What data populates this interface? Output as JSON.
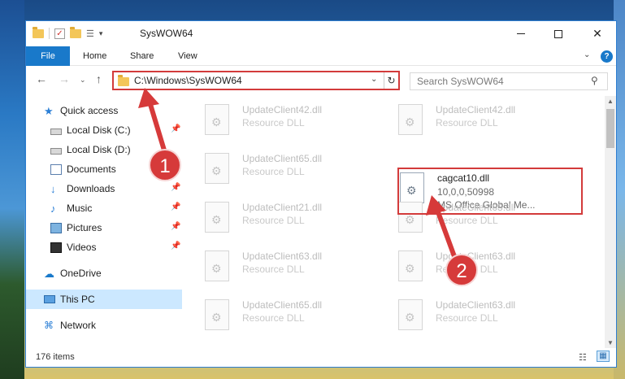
{
  "window": {
    "title": "SysWOW64",
    "controls": {
      "minimize": "—",
      "maximize": "☐",
      "close": "✕"
    }
  },
  "quick_access_toolbar": {
    "dropdown": "▾"
  },
  "ribbon": {
    "tabs": [
      "File",
      "Home",
      "Share",
      "View"
    ],
    "help": "?",
    "expand": "⌄"
  },
  "navigation": {
    "back": "←",
    "forward": "→",
    "recent": "⌄",
    "up": "↑",
    "address": "C:\\Windows\\SysWOW64",
    "address_dropdown": "⌄",
    "refresh": "↻",
    "search_placeholder": "Search SysWOW64",
    "search_icon": "⚲"
  },
  "sidebar": {
    "items": [
      {
        "label": "Quick access",
        "icon": "star-icon",
        "pinned": false
      },
      {
        "label": "Local Disk (C:)",
        "icon": "disk-icon",
        "pinned": true
      },
      {
        "label": "Local Disk (D:)",
        "icon": "disk-icon",
        "pinned": true
      },
      {
        "label": "Documents",
        "icon": "documents-icon",
        "pinned": true
      },
      {
        "label": "Downloads",
        "icon": "downloads-icon",
        "pinned": true
      },
      {
        "label": "Music",
        "icon": "music-icon",
        "pinned": true
      },
      {
        "label": "Pictures",
        "icon": "pictures-icon",
        "pinned": true
      },
      {
        "label": "Videos",
        "icon": "videos-icon",
        "pinned": true
      },
      {
        "label": "OneDrive",
        "icon": "onedrive-icon",
        "pinned": false
      },
      {
        "label": "This PC",
        "icon": "this-pc-icon",
        "pinned": false,
        "selected": true
      },
      {
        "label": "Network",
        "icon": "network-icon",
        "pinned": false
      }
    ],
    "pin_glyph": "📌"
  },
  "files": {
    "left_column": [
      {
        "name": "UpdateClient42.dll",
        "type": "Resource DLL"
      },
      {
        "name": "UpdateClient65.dll",
        "type": "Resource DLL"
      },
      {
        "name": "UpdateClient21.dll",
        "type": "Resource DLL"
      },
      {
        "name": "UpdateClient63.dll",
        "type": "Resource DLL"
      },
      {
        "name": "UpdateClient65.dll",
        "type": "Resource DLL"
      }
    ],
    "right_column": [
      {
        "name": "UpdateClient42.dll",
        "type": "Resource DLL"
      },
      {
        "name": "cagcat10.dll",
        "version": "10,0,0,50998",
        "type": "MS Office Global Me...",
        "highlighted": true
      },
      {
        "name": "UpdateClient63.dll",
        "type": "Resource DLL"
      },
      {
        "name": "UpdateClient63.dll",
        "type": "Resource DLL"
      },
      {
        "name": "UpdateClient63.dll",
        "type": "Resource DLL"
      }
    ]
  },
  "status": {
    "item_count": "176 items"
  },
  "view_toggles": {
    "details": "☷",
    "tiles": "▦"
  },
  "annotations": {
    "badge_1": "1",
    "badge_2": "2",
    "color": "#d63a3a"
  }
}
